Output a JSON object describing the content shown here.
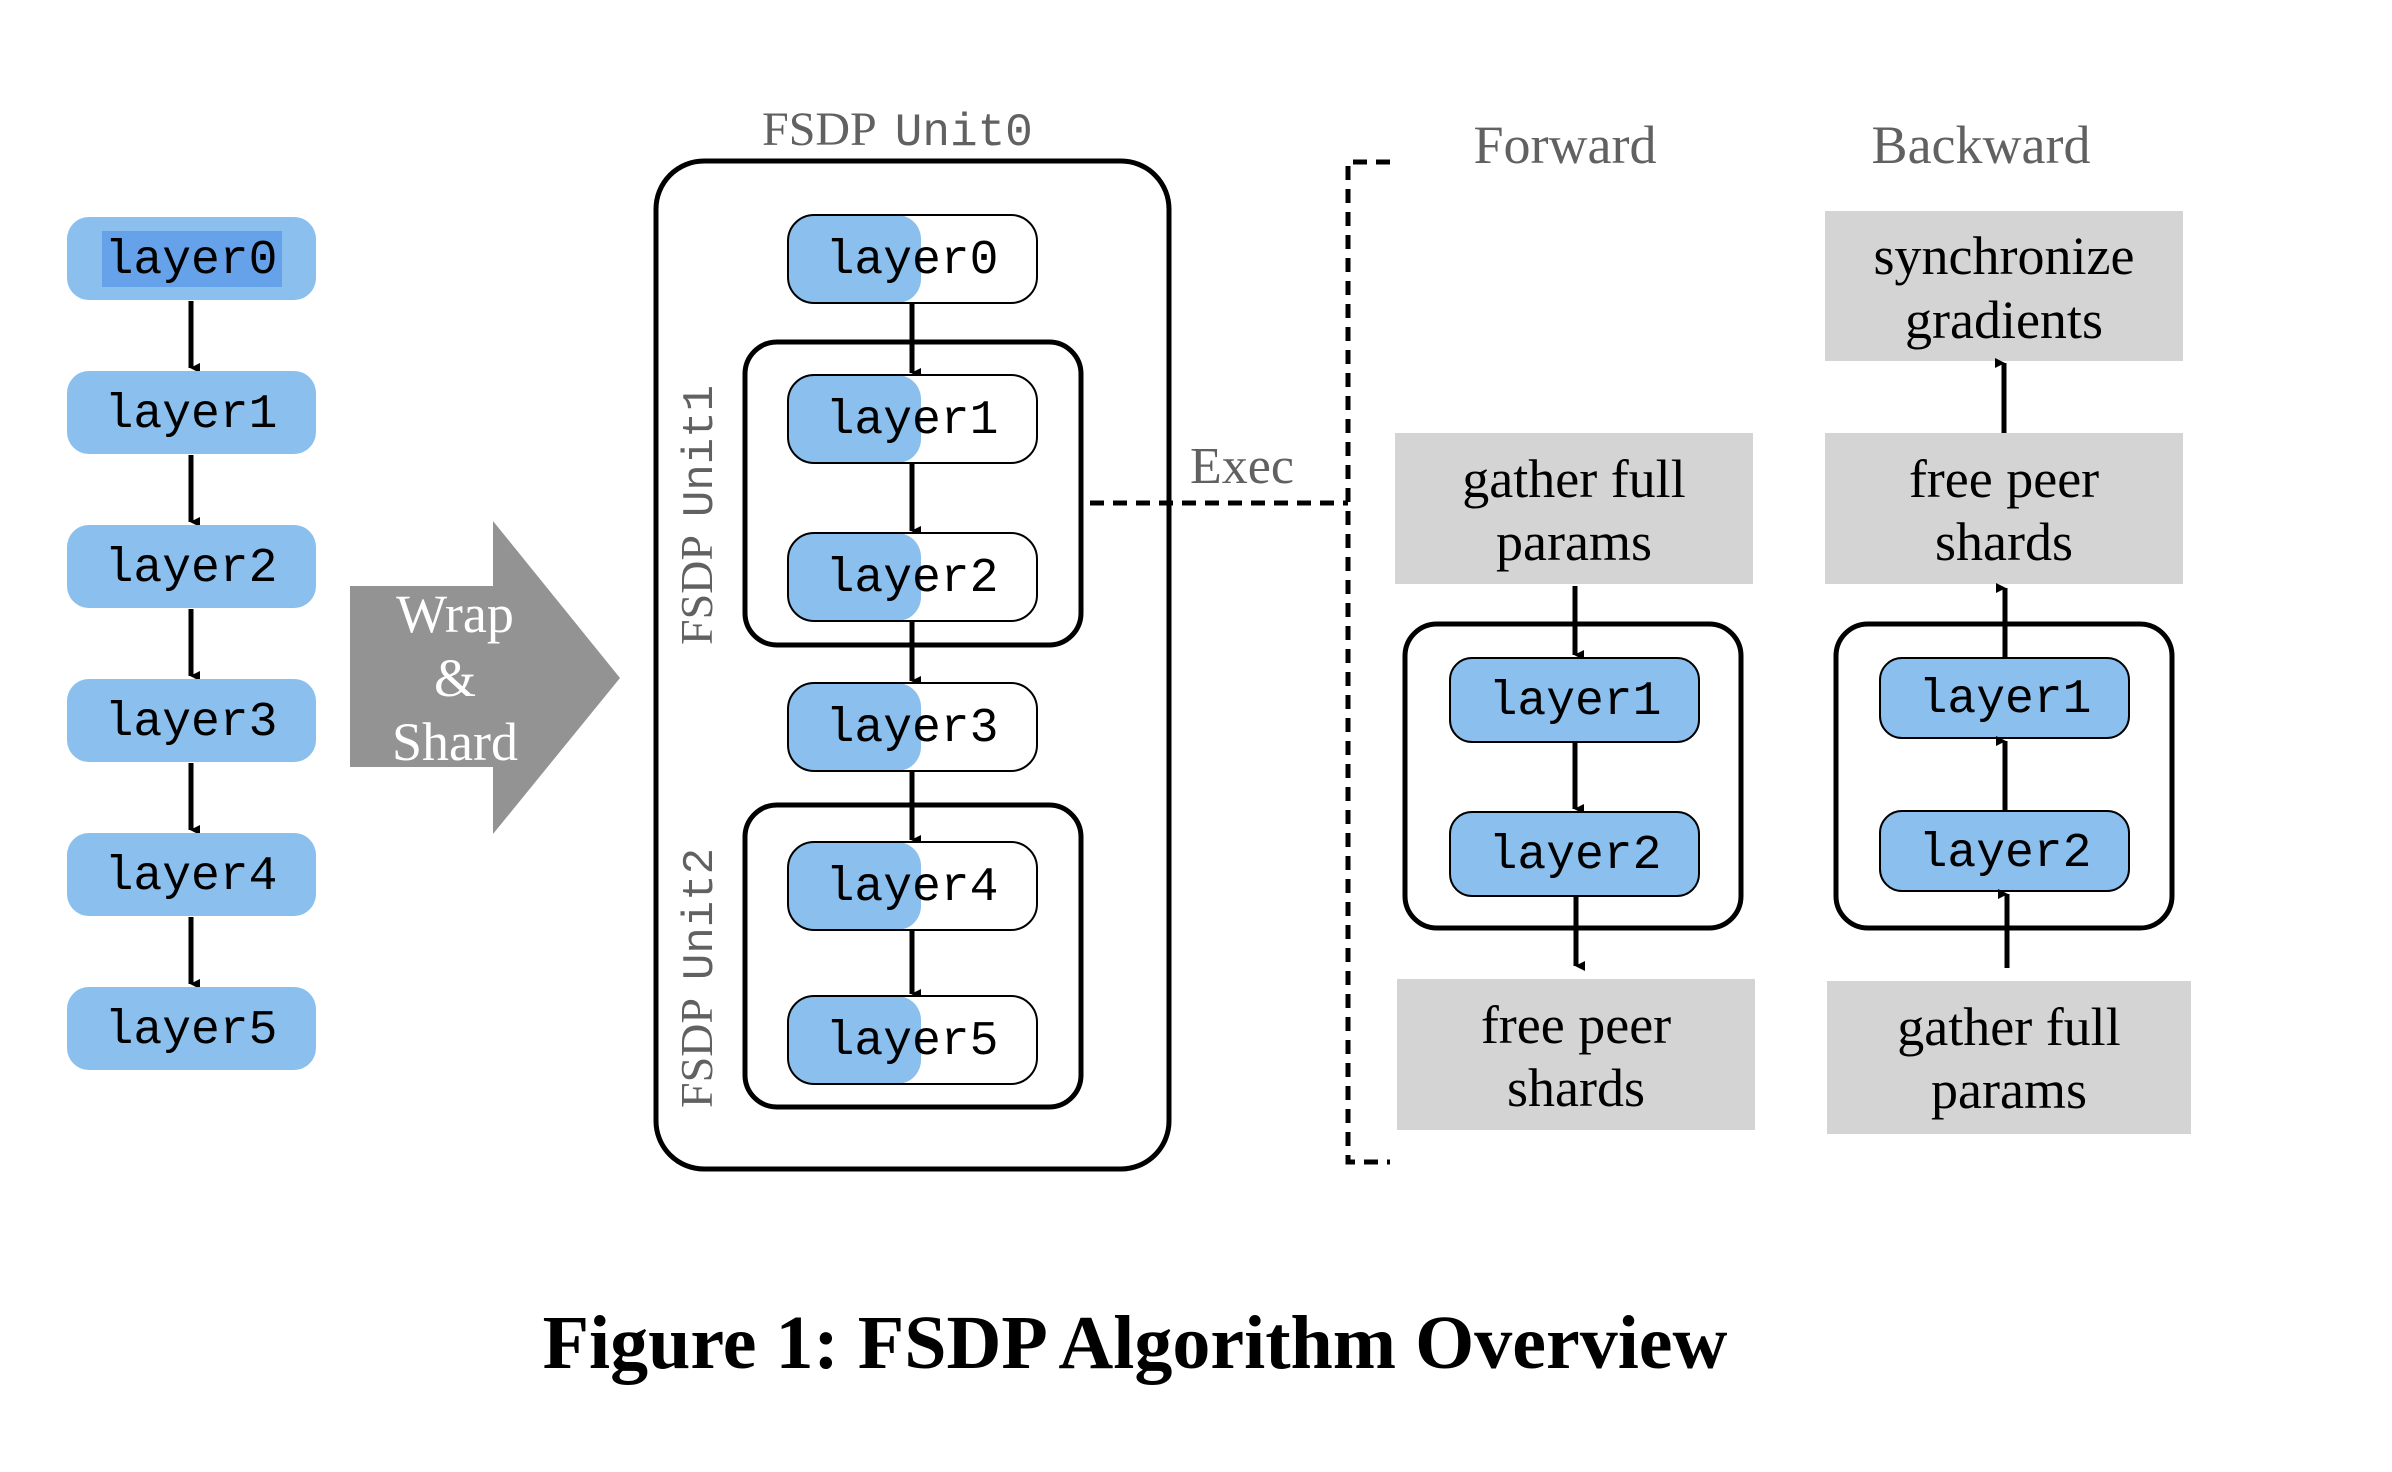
{
  "colors": {
    "layer_fill": "#8bbfee",
    "layer_highlight": "#66a2e9",
    "step_box_fill": "#d4d4d4",
    "wrap_arrow_fill": "#939393",
    "label_gray": "#616161",
    "line": "#000000"
  },
  "model": {
    "layers": [
      "layer0",
      "layer1",
      "layer2",
      "layer3",
      "layer4",
      "layer5"
    ],
    "selected_layer": "layer0"
  },
  "wrap_arrow": {
    "lines": [
      "Wrap",
      "&",
      "Shard"
    ]
  },
  "fsdp_units": {
    "outer_label_serif": "FSDP",
    "outer_label_mono": "Unit0",
    "unit1_label_serif": "FSDP",
    "unit1_label_mono": "Unit1",
    "unit2_label_serif": "FSDP",
    "unit2_label_mono": "Unit2",
    "layers": [
      "layer0",
      "layer1",
      "layer2",
      "layer3",
      "layer4",
      "layer5"
    ]
  },
  "exec_label": "Exec",
  "forward": {
    "title": "Forward",
    "pre_step": [
      "gather full",
      "params"
    ],
    "layers": [
      "layer1",
      "layer2"
    ],
    "post_step": [
      "free peer",
      "shards"
    ]
  },
  "backward": {
    "title": "Backward",
    "top_step": [
      "synchronize",
      "gradients"
    ],
    "mid_step": [
      "free peer",
      "shards"
    ],
    "layers": [
      "layer1",
      "layer2"
    ],
    "bottom_step": [
      "gather full",
      "params"
    ]
  },
  "caption": "Figure 1: FSDP Algorithm Overview"
}
